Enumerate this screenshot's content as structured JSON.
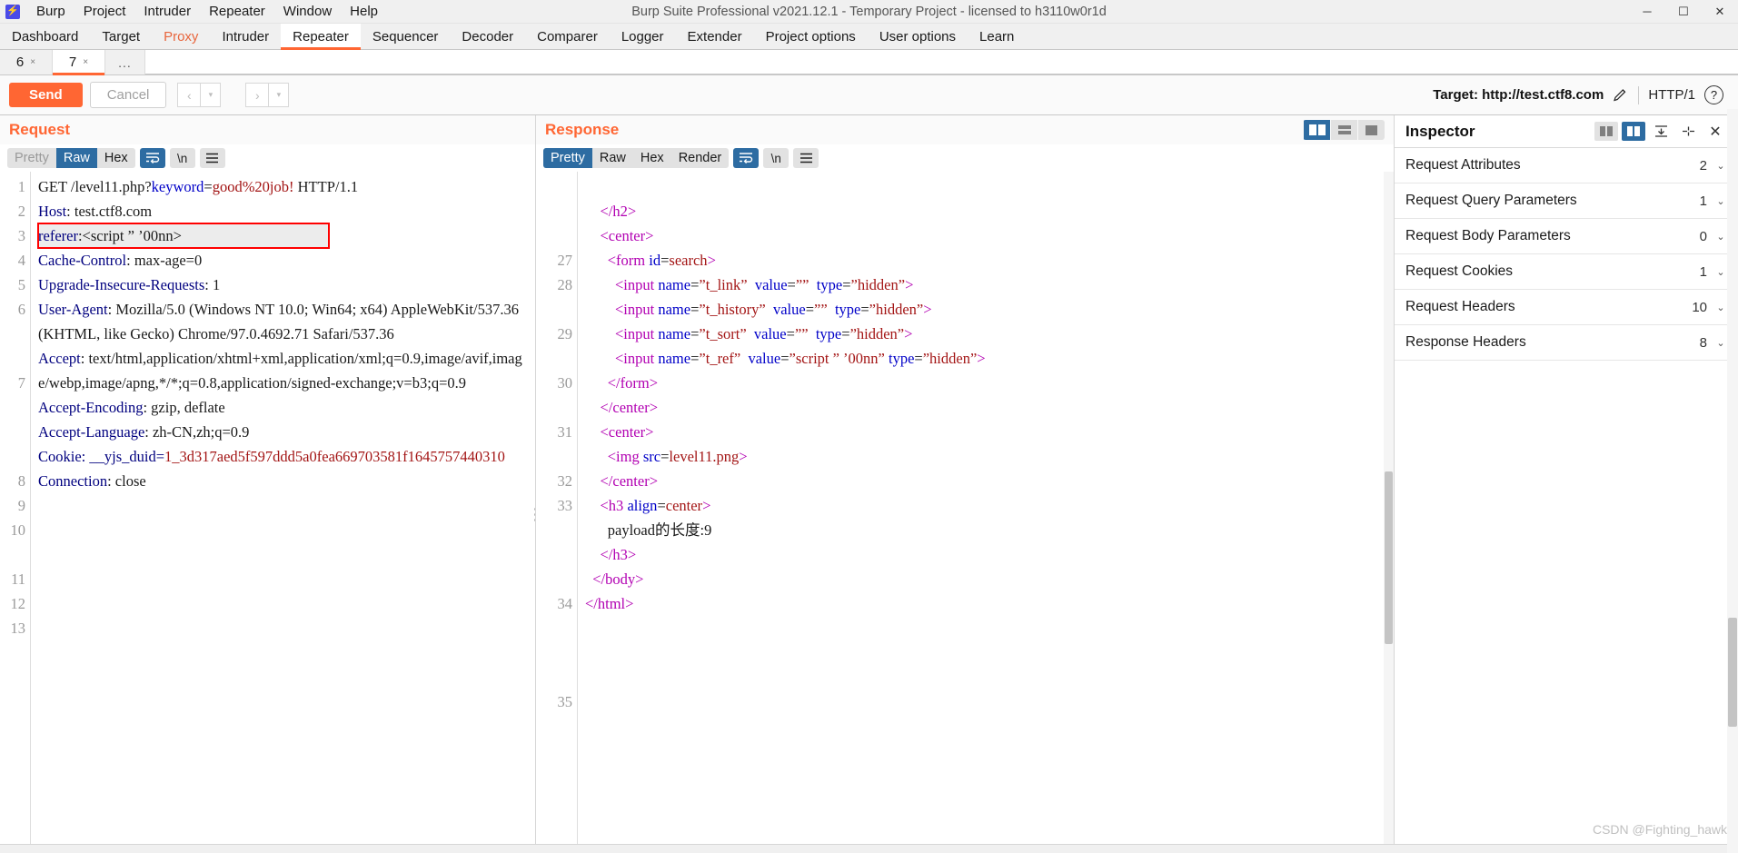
{
  "window": {
    "app_icon": "burp-logo-icon",
    "title": "Burp Suite Professional v2021.12.1 - Temporary Project - licensed to h3110w0r1d",
    "minimize": "─",
    "maximize": "☐",
    "close": "✕"
  },
  "menu": [
    "Burp",
    "Project",
    "Intruder",
    "Repeater",
    "Window",
    "Help"
  ],
  "main_tabs": [
    {
      "label": "Dashboard",
      "state": "normal"
    },
    {
      "label": "Target",
      "state": "normal"
    },
    {
      "label": "Proxy",
      "state": "accent"
    },
    {
      "label": "Intruder",
      "state": "normal"
    },
    {
      "label": "Repeater",
      "state": "active"
    },
    {
      "label": "Sequencer",
      "state": "normal"
    },
    {
      "label": "Decoder",
      "state": "normal"
    },
    {
      "label": "Comparer",
      "state": "normal"
    },
    {
      "label": "Logger",
      "state": "normal"
    },
    {
      "label": "Extender",
      "state": "normal"
    },
    {
      "label": "Project options",
      "state": "normal"
    },
    {
      "label": "User options",
      "state": "normal"
    },
    {
      "label": "Learn",
      "state": "normal"
    }
  ],
  "repeater_tabs": [
    {
      "label": "6",
      "close": "×",
      "active": false
    },
    {
      "label": "7",
      "close": "×",
      "active": true
    }
  ],
  "repeater_more": "...",
  "actions": {
    "send": "Send",
    "cancel": "Cancel",
    "back": "‹",
    "back_drop": "▾",
    "forward": "›",
    "forward_drop": "▾",
    "target_label": "Target: http://test.ctf8.com",
    "edit_icon": "pencil-icon",
    "http_version": "HTTP/1",
    "help_icon": "?"
  },
  "request": {
    "title": "Request",
    "format_tabs": [
      {
        "label": "Pretty",
        "state": "dim"
      },
      {
        "label": "Raw",
        "state": "active"
      },
      {
        "label": "Hex",
        "state": "normal"
      }
    ],
    "wrap_icon": "word-wrap-icon",
    "newline_label": "\\n",
    "menu_icon": "hamburger-icon",
    "lines": [
      {
        "num": "1",
        "rows": 1,
        "parts": [
          {
            "t": "GET /level11.php?",
            "c": "plain"
          },
          {
            "t": "keyword",
            "c": "blue"
          },
          {
            "t": "=",
            "c": "plain"
          },
          {
            "t": "good%20job!",
            "c": "val-red"
          },
          {
            "t": " HTTP/1.1",
            "c": "plain"
          }
        ]
      },
      {
        "num": "2",
        "rows": 1,
        "parts": [
          {
            "t": "Host",
            "c": "hdr"
          },
          {
            "t": ": test.ctf8.com",
            "c": "plain"
          }
        ]
      },
      {
        "num": "3",
        "rows": 1,
        "highlight": true,
        "parts": [
          {
            "t": "referer",
            "c": "hdr"
          },
          {
            "t": ":<script ” ’00nn>",
            "c": "plain"
          }
        ]
      },
      {
        "num": "4",
        "rows": 1,
        "parts": [
          {
            "t": "Cache-Control",
            "c": "hdr"
          },
          {
            "t": ": max-age=0",
            "c": "plain"
          }
        ]
      },
      {
        "num": "5",
        "rows": 1,
        "parts": [
          {
            "t": "Upgrade-Insecure-Requests",
            "c": "hdr"
          },
          {
            "t": ": 1",
            "c": "plain"
          }
        ]
      },
      {
        "num": "6",
        "rows": 3,
        "parts": [
          {
            "t": "User-Agent",
            "c": "hdr"
          },
          {
            "t": ": Mozilla/5.0 (Windows NT 10.0; Win64; x64) AppleWebKit/537.36 (KHTML, like Gecko) Chrome/97.0.4692.71 Safari/537.36",
            "c": "plain"
          }
        ]
      },
      {
        "num": "7",
        "rows": 4,
        "parts": [
          {
            "t": "Accept",
            "c": "hdr"
          },
          {
            "t": ": text/html,application/xhtml+xml,application/xml;q=0.9,image/avif,image/webp,image/apng,*/*;q=0.8,application/signed-exchange;v=b3;q=0.9",
            "c": "plain"
          }
        ]
      },
      {
        "num": "8",
        "rows": 1,
        "parts": [
          {
            "t": "Accept-Encoding",
            "c": "hdr"
          },
          {
            "t": ": gzip, deflate",
            "c": "plain"
          }
        ]
      },
      {
        "num": "9",
        "rows": 1,
        "parts": [
          {
            "t": "Accept-Language",
            "c": "hdr"
          },
          {
            "t": ": zh-CN,zh;q=0.9",
            "c": "plain"
          }
        ]
      },
      {
        "num": "10",
        "rows": 2,
        "parts": [
          {
            "t": "Cookie",
            "c": "hdr"
          },
          {
            "t": ": __yjs_duid=",
            "c": "hdr"
          },
          {
            "t": "1_3d317aed5f597ddd5a0fea669703581f1645757440310",
            "c": "val-red"
          }
        ]
      },
      {
        "num": "11",
        "rows": 1,
        "parts": [
          {
            "t": "Connection",
            "c": "hdr"
          },
          {
            "t": ": close",
            "c": "plain"
          }
        ]
      },
      {
        "num": "12",
        "rows": 1,
        "parts": [
          {
            "t": "",
            "c": "plain"
          }
        ]
      },
      {
        "num": "13",
        "rows": 1,
        "parts": [
          {
            "t": "",
            "c": "plain"
          }
        ]
      }
    ]
  },
  "response": {
    "title": "Response",
    "format_tabs": [
      {
        "label": "Pretty",
        "state": "active"
      },
      {
        "label": "Raw",
        "state": "normal"
      },
      {
        "label": "Hex",
        "state": "normal"
      },
      {
        "label": "Render",
        "state": "normal"
      }
    ],
    "wrap_icon": "word-wrap-icon",
    "newline_label": "\\n",
    "menu_icon": "hamburger-icon",
    "layout_buttons": [
      {
        "icon": "split-vertical-icon",
        "active": true
      },
      {
        "icon": "split-horizontal-icon",
        "active": false
      },
      {
        "icon": "single-pane-icon",
        "active": false
      }
    ],
    "lines": [
      {
        "num": "",
        "rows": 1,
        "clipped": true,
        "parts": [
          {
            "t": "    ",
            "c": "plain"
          }
        ]
      },
      {
        "num": "",
        "rows": 1,
        "parts": [
          {
            "t": "    ",
            "c": "plain"
          },
          {
            "t": "</h2>",
            "c": "magenta"
          }
        ]
      },
      {
        "num": "",
        "rows": 1,
        "parts": [
          {
            "t": "    ",
            "c": "plain"
          },
          {
            "t": "<center>",
            "c": "magenta"
          }
        ]
      },
      {
        "num": "27",
        "rows": 1,
        "parts": [
          {
            "t": "      ",
            "c": "plain"
          },
          {
            "t": "<form ",
            "c": "magenta"
          },
          {
            "t": "id",
            "c": "blue"
          },
          {
            "t": "=",
            "c": "plain"
          },
          {
            "t": "search",
            "c": "darkred"
          },
          {
            "t": ">",
            "c": "magenta"
          }
        ]
      },
      {
        "num": "28",
        "rows": 2,
        "parts": [
          {
            "t": "        ",
            "c": "plain"
          },
          {
            "t": "<input ",
            "c": "magenta"
          },
          {
            "t": "name",
            "c": "blue"
          },
          {
            "t": "=",
            "c": "plain"
          },
          {
            "t": "”t_link”",
            "c": "darkred"
          },
          {
            "t": "  ",
            "c": "plain"
          },
          {
            "t": "value",
            "c": "blue"
          },
          {
            "t": "=",
            "c": "plain"
          },
          {
            "t": "””",
            "c": "darkred"
          },
          {
            "t": "  ",
            "c": "plain"
          },
          {
            "t": "type",
            "c": "blue"
          },
          {
            "t": "=",
            "c": "plain"
          },
          {
            "t": "”hidden”",
            "c": "darkred"
          },
          {
            "t": ">",
            "c": "magenta"
          }
        ]
      },
      {
        "num": "29",
        "rows": 2,
        "parts": [
          {
            "t": "        ",
            "c": "plain"
          },
          {
            "t": "<input ",
            "c": "magenta"
          },
          {
            "t": "name",
            "c": "blue"
          },
          {
            "t": "=",
            "c": "plain"
          },
          {
            "t": "”t_history”",
            "c": "darkred"
          },
          {
            "t": "  ",
            "c": "plain"
          },
          {
            "t": "value",
            "c": "blue"
          },
          {
            "t": "=",
            "c": "plain"
          },
          {
            "t": "””",
            "c": "darkred"
          },
          {
            "t": "  ",
            "c": "plain"
          },
          {
            "t": "type",
            "c": "blue"
          },
          {
            "t": "=",
            "c": "plain"
          },
          {
            "t": "”hidden”",
            "c": "darkred"
          },
          {
            "t": ">",
            "c": "magenta"
          }
        ]
      },
      {
        "num": "30",
        "rows": 2,
        "parts": [
          {
            "t": "        ",
            "c": "plain"
          },
          {
            "t": "<input ",
            "c": "magenta"
          },
          {
            "t": "name",
            "c": "blue"
          },
          {
            "t": "=",
            "c": "plain"
          },
          {
            "t": "”t_sort”",
            "c": "darkred"
          },
          {
            "t": "  ",
            "c": "plain"
          },
          {
            "t": "value",
            "c": "blue"
          },
          {
            "t": "=",
            "c": "plain"
          },
          {
            "t": "””",
            "c": "darkred"
          },
          {
            "t": "  ",
            "c": "plain"
          },
          {
            "t": "type",
            "c": "blue"
          },
          {
            "t": "=",
            "c": "plain"
          },
          {
            "t": "”hidden”",
            "c": "darkred"
          },
          {
            "t": ">",
            "c": "magenta"
          }
        ]
      },
      {
        "num": "31",
        "rows": 2,
        "parts": [
          {
            "t": "        ",
            "c": "plain"
          },
          {
            "t": "<input ",
            "c": "magenta"
          },
          {
            "t": "name",
            "c": "blue"
          },
          {
            "t": "=",
            "c": "plain"
          },
          {
            "t": "”t_ref”",
            "c": "darkred"
          },
          {
            "t": "  ",
            "c": "plain"
          },
          {
            "t": "value",
            "c": "blue"
          },
          {
            "t": "=",
            "c": "plain"
          },
          {
            "t": "”script ” ’00nn”",
            "c": "darkred"
          },
          {
            "t": " ",
            "c": "plain"
          },
          {
            "t": "type",
            "c": "blue"
          },
          {
            "t": "=",
            "c": "plain"
          },
          {
            "t": "”hidden”",
            "c": "darkred"
          },
          {
            "t": ">",
            "c": "magenta"
          }
        ]
      },
      {
        "num": "32",
        "rows": 1,
        "parts": [
          {
            "t": "      ",
            "c": "plain"
          },
          {
            "t": "</form>",
            "c": "magenta"
          }
        ]
      },
      {
        "num": "33",
        "rows": 1,
        "parts": [
          {
            "t": "    ",
            "c": "plain"
          },
          {
            "t": "</center>",
            "c": "magenta"
          }
        ]
      },
      {
        "num": "",
        "rows": 1,
        "parts": [
          {
            "t": "    ",
            "c": "plain"
          },
          {
            "t": "<center>",
            "c": "magenta"
          }
        ]
      },
      {
        "num": "",
        "rows": 1,
        "parts": [
          {
            "t": "      ",
            "c": "plain"
          },
          {
            "t": "<img ",
            "c": "magenta"
          },
          {
            "t": "src",
            "c": "blue"
          },
          {
            "t": "=",
            "c": "plain"
          },
          {
            "t": "level11.png",
            "c": "darkred"
          },
          {
            "t": ">",
            "c": "magenta"
          }
        ]
      },
      {
        "num": "",
        "rows": 1,
        "parts": [
          {
            "t": "    ",
            "c": "plain"
          },
          {
            "t": "</center>",
            "c": "magenta"
          }
        ]
      },
      {
        "num": "34",
        "rows": 1,
        "parts": [
          {
            "t": "    ",
            "c": "plain"
          },
          {
            "t": "<h3 ",
            "c": "magenta"
          },
          {
            "t": "align",
            "c": "blue"
          },
          {
            "t": "=",
            "c": "plain"
          },
          {
            "t": "center",
            "c": "darkred"
          },
          {
            "t": ">",
            "c": "magenta"
          }
        ]
      },
      {
        "num": "",
        "rows": 1,
        "parts": [
          {
            "t": "      payload的长度:9",
            "c": "plain"
          }
        ]
      },
      {
        "num": "",
        "rows": 1,
        "parts": [
          {
            "t": "    ",
            "c": "plain"
          },
          {
            "t": "</h3>",
            "c": "magenta"
          }
        ]
      },
      {
        "num": "",
        "rows": 1,
        "parts": [
          {
            "t": "  ",
            "c": "plain"
          },
          {
            "t": "</body>",
            "c": "magenta"
          }
        ]
      },
      {
        "num": "35",
        "rows": 1,
        "parts": [
          {
            "t": "",
            "c": "plain"
          },
          {
            "t": "</html>",
            "c": "magenta"
          }
        ]
      }
    ]
  },
  "inspector": {
    "title": "Inspector",
    "icons": [
      {
        "name": "panel-left-icon",
        "active": false
      },
      {
        "name": "panel-right-icon",
        "active": true
      },
      {
        "name": "collapse-all-icon",
        "active": false
      },
      {
        "name": "expand-all-icon",
        "active": false
      },
      {
        "name": "close-icon",
        "active": false
      }
    ],
    "close_glyph": "✕",
    "sections": [
      {
        "label": "Request Attributes",
        "count": "2",
        "chevron": "⌄"
      },
      {
        "label": "Request Query Parameters",
        "count": "1",
        "chevron": "⌄"
      },
      {
        "label": "Request Body Parameters",
        "count": "0",
        "chevron": "⌄"
      },
      {
        "label": "Request Cookies",
        "count": "1",
        "chevron": "⌄"
      },
      {
        "label": "Request Headers",
        "count": "10",
        "chevron": "⌄"
      },
      {
        "label": "Response Headers",
        "count": "8",
        "chevron": "⌄"
      }
    ]
  },
  "watermark": "CSDN @Fighting_hawk",
  "colors": {
    "accent": "#ff6633",
    "selection_blue": "#2d6ca2",
    "header_blue": "#00007f",
    "value_red": "#a31515",
    "tag_magenta": "#b200b2",
    "attr_blue": "#0000c8"
  }
}
